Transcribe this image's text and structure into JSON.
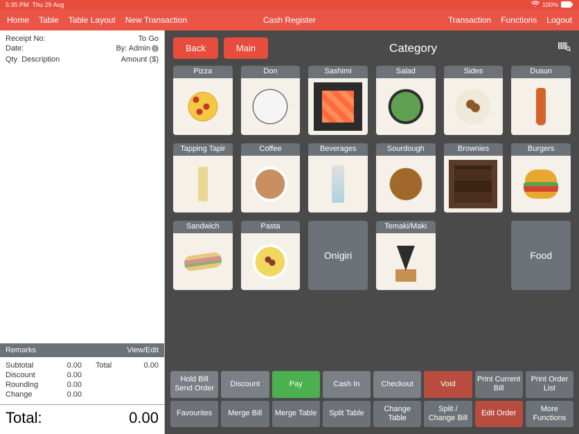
{
  "statusbar": {
    "time": "5:35 PM",
    "date": "Thu 29 Aug",
    "battery": "100%"
  },
  "topnav": {
    "left": [
      "Home",
      "Table",
      "Table Layout",
      "New Transaction"
    ],
    "title": "Cash Register",
    "right": [
      "Transaction",
      "Functions",
      "Logout"
    ]
  },
  "receipt": {
    "receipt_no_label": "Receipt No:",
    "receipt_status": "To Go",
    "date_label": "Date:",
    "by_label": "By: Admin",
    "qty_label": "Qty",
    "desc_label": "Description",
    "amount_label": "Amount ($)",
    "remarks_label": "Remarks",
    "view_edit": "View/Edit",
    "subtotal_label": "Subtotal",
    "subtotal": "0.00",
    "discount_label": "Discount",
    "discount": "0.00",
    "rounding_label": "Rounding",
    "rounding": "0.00",
    "change_label": "Change",
    "change": "0.00",
    "total_label2": "Total",
    "total2": "0.00",
    "grand_label": "Total:",
    "grand": "0.00"
  },
  "catbar": {
    "back": "Back",
    "main": "Main",
    "title": "Category"
  },
  "categories": [
    {
      "label": "Pizza",
      "img": "pizza"
    },
    {
      "label": "Don",
      "img": "don"
    },
    {
      "label": "Sashimi",
      "img": "sashimi"
    },
    {
      "label": "Salad",
      "img": "salad"
    },
    {
      "label": "Sides",
      "img": "sides"
    },
    {
      "label": "Dusun",
      "img": "dusun"
    },
    {
      "label": "Tapping Tapir",
      "img": "tapir"
    },
    {
      "label": "Coffee",
      "img": "coffee"
    },
    {
      "label": "Beverages",
      "img": "bev"
    },
    {
      "label": "Sourdough",
      "img": "sour"
    },
    {
      "label": "Brownies",
      "img": "brown"
    },
    {
      "label": "Burgers",
      "img": "burger"
    },
    {
      "label": "Sandwich",
      "img": "sand"
    },
    {
      "label": "Pasta",
      "img": "pasta"
    },
    {
      "label": "Onigiri",
      "img": null
    },
    {
      "label": "Temaki/Maki",
      "img": "temaki"
    },
    {
      "label": "",
      "img": null,
      "blank": true
    },
    {
      "label": "Food",
      "img": null
    }
  ],
  "actions": {
    "row1": [
      {
        "t": "Hold Bill\nSend Order",
        "c": "g"
      },
      {
        "t": "Discount",
        "c": "g"
      },
      {
        "t": "Pay",
        "c": "gr"
      },
      {
        "t": "Cash In",
        "c": "g"
      },
      {
        "t": "Checkout",
        "c": "g"
      },
      {
        "t": "Void",
        "c": "rd"
      },
      {
        "t": "Print Current Bill",
        "c": "dg"
      },
      {
        "t": "Print Order List",
        "c": "dg"
      }
    ],
    "row2": [
      {
        "t": "Favourites",
        "c": "dg"
      },
      {
        "t": "Merge Bill",
        "c": "dg"
      },
      {
        "t": "Merge Table",
        "c": "dg"
      },
      {
        "t": "Split Table",
        "c": "dg"
      },
      {
        "t": "Change Table",
        "c": "dg"
      },
      {
        "t": "Split / Change Bill",
        "c": "dg"
      },
      {
        "t": "Edit Order",
        "c": "rd"
      },
      {
        "t": "More Functions",
        "c": "dg"
      }
    ]
  }
}
